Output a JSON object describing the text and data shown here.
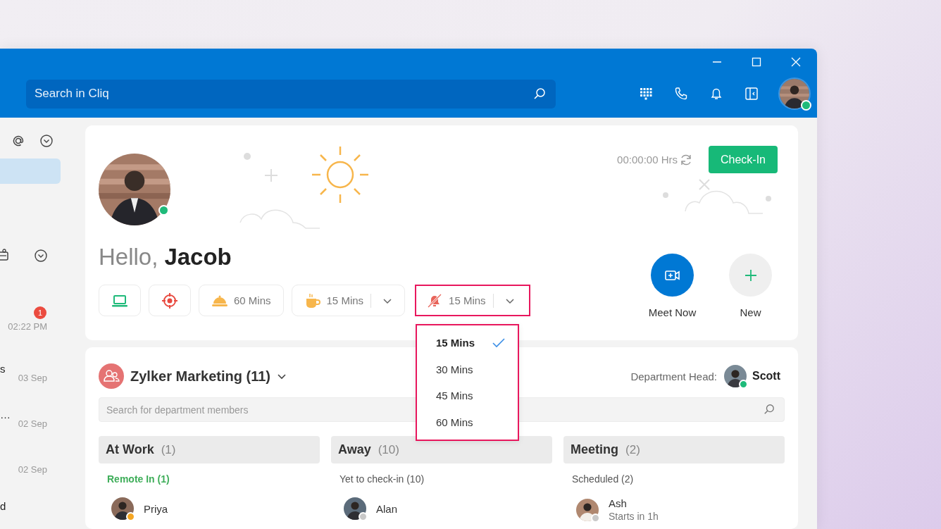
{
  "search": {
    "placeholder": "Search in Cliq"
  },
  "sidebar": {
    "items": [
      {
        "time": "02:22 PM",
        "unread": "1"
      },
      {
        "name": "s",
        "time": "03 Sep"
      },
      {
        "name": "…",
        "time": "02 Sep"
      },
      {
        "time": "02 Sep"
      },
      {
        "name": "d"
      }
    ]
  },
  "profile": {
    "greeting": "Hello,",
    "name": "Jacob"
  },
  "timer": {
    "text": "00:00:00 Hrs"
  },
  "check_in": "Check-In",
  "status_chips": [
    {
      "kind": "remote"
    },
    {
      "kind": "office"
    },
    {
      "kind": "lunch",
      "duration": "60 Mins"
    },
    {
      "kind": "break",
      "duration": "15 Mins",
      "dropdown": true
    },
    {
      "kind": "dnd",
      "duration": "15 Mins",
      "dropdown": true,
      "highlighted": true
    }
  ],
  "dnd_menu": {
    "highlighted": true,
    "options": [
      {
        "label": "15 Mins",
        "selected": true
      },
      {
        "label": "30 Mins",
        "selected": false
      },
      {
        "label": "45 Mins",
        "selected": false
      },
      {
        "label": "60 Mins",
        "selected": false
      }
    ]
  },
  "actions": [
    {
      "kind": "meet",
      "label": "Meet Now"
    },
    {
      "kind": "new",
      "label": "New"
    }
  ],
  "department": {
    "name": "Zylker Marketing (11)",
    "head_label": "Department Head:",
    "head_name": "Scott",
    "search_placeholder": "Search for department members",
    "columns": [
      {
        "title": "At Work",
        "count": "(1)",
        "group": "Remote In (1)",
        "color": "#3fae5a",
        "members": [
          {
            "name": "Priya",
            "color": "#f5a623"
          }
        ]
      },
      {
        "title": "Away",
        "count": "(10)",
        "group": "Yet to check-in (10)",
        "color": "#555555",
        "members": [
          {
            "name": "Alan",
            "color": "#c9c9c9"
          }
        ]
      },
      {
        "title": "Meeting",
        "count": "(2)",
        "group": "Scheduled (2)",
        "color": "#555555",
        "members": [
          {
            "name": "Ash",
            "note": "Starts in 1h",
            "color": "#c9c9c9"
          }
        ]
      }
    ]
  }
}
